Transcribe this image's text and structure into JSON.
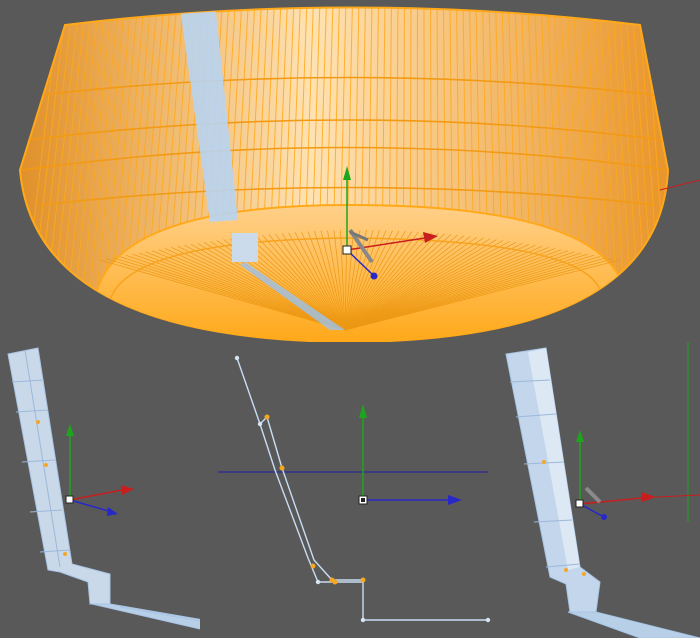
{
  "app": {
    "background_color": "#595959"
  },
  "scene": {
    "object": "bowl-lathe-mesh",
    "mesh_color": "#FFA91A",
    "mesh_highlight_color": "#FFE0B0",
    "selection_color": "#B8D4F2",
    "vertex_color": "#F5A623"
  },
  "gizmo": {
    "x_axis_color": "#C81E1E",
    "y_axis_color": "#1EA51E",
    "z_axis_color": "#2828C8",
    "icons": [
      "move-gizmo-icon",
      "pivot-handle-icon"
    ]
  },
  "viewports": [
    {
      "id": "perspective",
      "icon": "bowl-wireframe"
    },
    {
      "id": "left-profile",
      "icon": "profile-strip"
    },
    {
      "id": "spline-profile",
      "icon": "spline-outline"
    },
    {
      "id": "right-profile",
      "icon": "profile-strip"
    }
  ]
}
